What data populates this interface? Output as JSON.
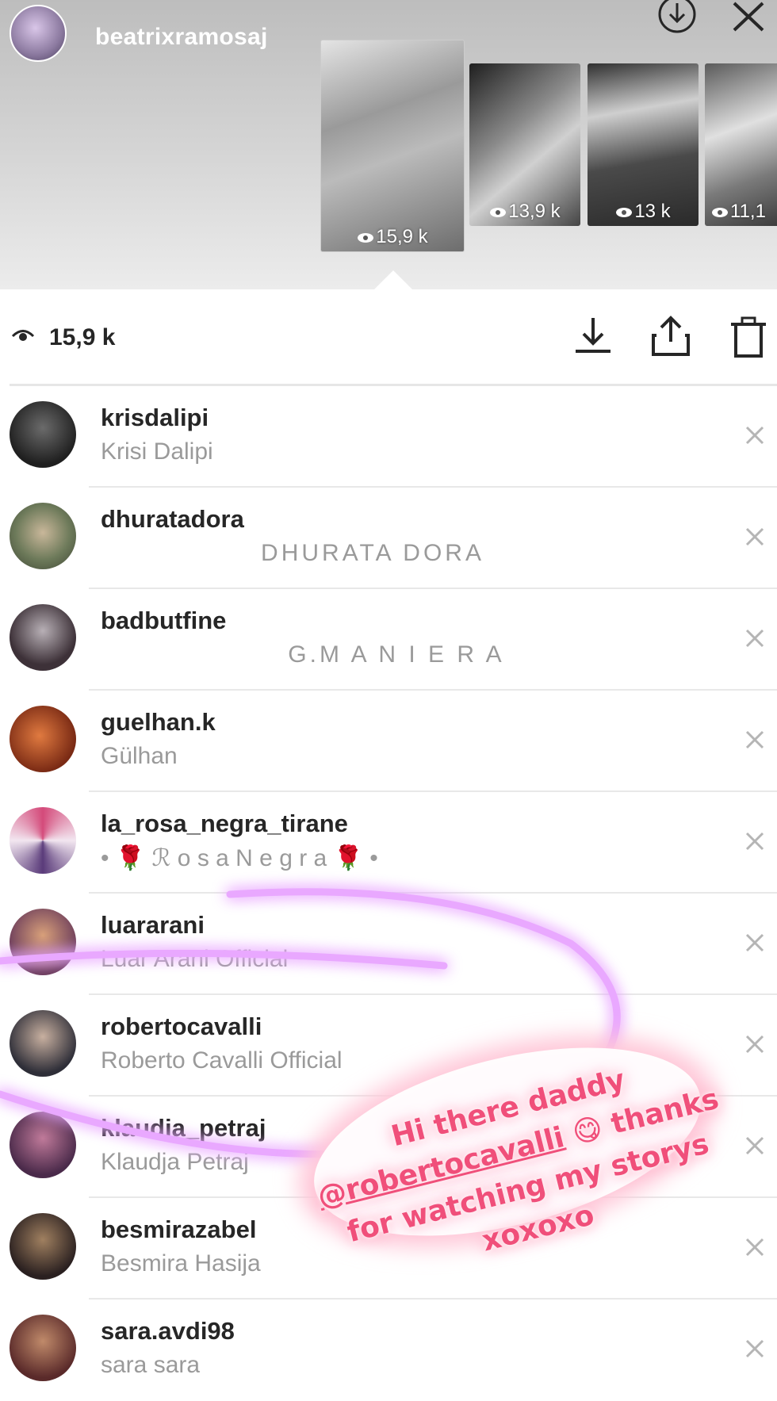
{
  "story_header": {
    "username": "beatrixramosaj",
    "thumbnails": [
      {
        "views": "15,9 k"
      },
      {
        "views": "13,9 k"
      },
      {
        "views": "13 k"
      },
      {
        "views": "11,1"
      }
    ]
  },
  "stats": {
    "view_count": "15,9 k"
  },
  "viewers": [
    {
      "username": "krisdalipi",
      "full_name": "Krisi Dalipi",
      "centered": false
    },
    {
      "username": "dhuratadora",
      "full_name": "DHURATA DORA",
      "centered": true
    },
    {
      "username": "badbutfine",
      "full_name": "G.M A N I E R A",
      "centered": true
    },
    {
      "username": "guelhan.k",
      "full_name": "Gülhan",
      "centered": false
    },
    {
      "username": "la_rosa_negra_tirane",
      "full_name": "• 🌹 ℛ o s a  N e g r a 🌹 •",
      "centered": false
    },
    {
      "username": "luararani",
      "full_name": "Luar Arani Official",
      "centered": false
    },
    {
      "username": "robertocavalli",
      "full_name": "Roberto Cavalli Official",
      "centered": false
    },
    {
      "username": "klaudja_petraj",
      "full_name": "Klaudja Petraj",
      "centered": false
    },
    {
      "username": "besmirazabel",
      "full_name": "Besmira Hasija",
      "centered": false
    },
    {
      "username": "sara.avdi98",
      "full_name": "sara sara",
      "centered": false
    }
  ],
  "overlay_text": {
    "line1": "Hi there daddy",
    "mention": "@robertocavalli",
    "emoji": "😋",
    "line2_rest": " thanks",
    "line3": "for watching my storys",
    "line4": "xoxoxo"
  },
  "colors": {
    "neon_purple": "#d98cff",
    "note_pink": "#f04f7a"
  }
}
